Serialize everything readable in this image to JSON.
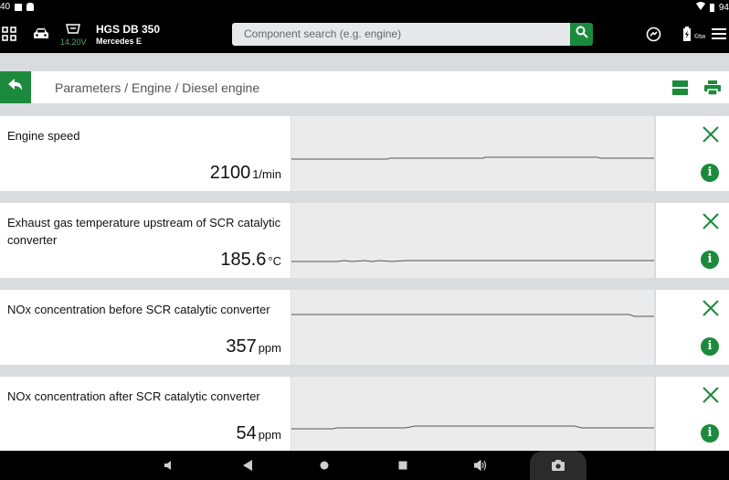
{
  "statusbar": {
    "time": "40",
    "battery": "94"
  },
  "topbar": {
    "voltage": "14.20V",
    "device_name": "HGS DB 350",
    "vehicle": "Mercedes E",
    "search_placeholder": "Component search (e.g. engine)",
    "battery_label": "©tw"
  },
  "breadcrumb": "Parameters / Engine / Diesel engine",
  "parameters": [
    {
      "name": "Engine speed",
      "value": "2100",
      "unit": "1/min"
    },
    {
      "name": "Exhaust gas temperature upstream of SCR catalytic converter",
      "value": "185.6",
      "unit": "°C"
    },
    {
      "name": "NOx concentration before SCR catalytic converter",
      "value": "357",
      "unit": "ppm"
    },
    {
      "name": "NOx concentration after SCR catalytic converter",
      "value": "54",
      "unit": "ppm"
    }
  ],
  "colors": {
    "accent": "#1c8a3c",
    "voltage": "#4aa864",
    "bar": "#000000"
  }
}
